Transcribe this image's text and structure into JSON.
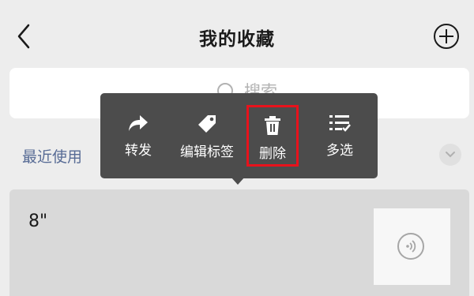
{
  "header": {
    "title": "我的收藏"
  },
  "search": {
    "placeholder": "搜索"
  },
  "section": {
    "recent_label": "最近使用"
  },
  "context_menu": {
    "items": [
      {
        "label": "转发",
        "icon": "forward-icon"
      },
      {
        "label": "编辑标签",
        "icon": "tag-icon"
      },
      {
        "label": "删除",
        "icon": "trash-icon"
      },
      {
        "label": "多选",
        "icon": "multi-select-icon"
      }
    ],
    "highlight_color": "#e8121c"
  },
  "card": {
    "title": "8\"",
    "thumbnail_icon": "voice-icon"
  }
}
